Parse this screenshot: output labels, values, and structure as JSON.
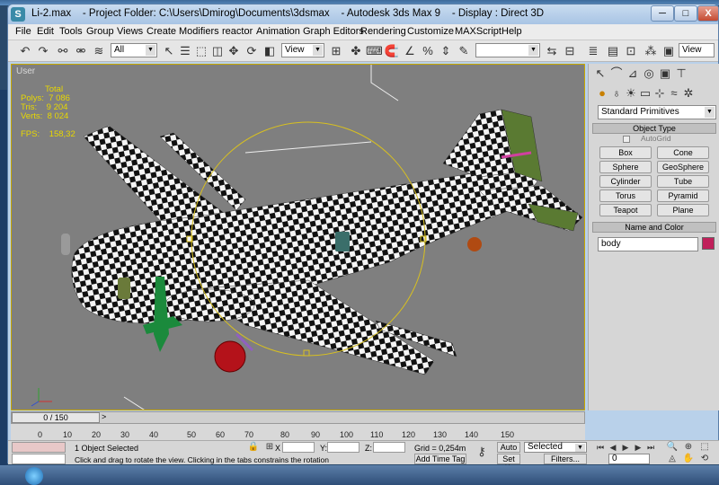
{
  "window": {
    "title": "Li-2.max    - Project Folder: C:\\Users\\Dmirog\\Documents\\3dsmax    - Autodesk 3ds Max 9    - Display : Direct 3D",
    "icon": "3dsmax-app-icon",
    "controls": {
      "minimize": "─",
      "maximize": "□",
      "close": "X"
    }
  },
  "menu": [
    "File",
    "Edit",
    "Tools",
    "Group",
    "Views",
    "Create",
    "Modifiers",
    "reactor",
    "Animation",
    "Graph Editors",
    "Rendering",
    "Customize",
    "MAXScript",
    "Help"
  ],
  "toolbar": {
    "selection_filter": "All",
    "ref_coord": "View",
    "named_selection": "",
    "view_combo_right": "View"
  },
  "viewport": {
    "label": "User",
    "stats_header": "Total",
    "polys": "Polys:  7 086",
    "tris": "Tris:    9 204",
    "verts": "Verts:  8 024",
    "fps": "FPS:    158,32",
    "background_color": "#7f7f7f",
    "selection_color": "#c8a800"
  },
  "command_panel": {
    "category": "Standard Primitives",
    "object_type_header": "Object Type",
    "autogrid": "AutoGrid",
    "buttons": [
      "Box",
      "Cone",
      "Sphere",
      "GeoSphere",
      "Cylinder",
      "Tube",
      "Torus",
      "Pyramid",
      "Teapot",
      "Plane"
    ],
    "name_color_header": "Name and Color",
    "object_name": "body",
    "object_color": "#c0205a"
  },
  "time": {
    "slider": "0 / 150",
    "ticks": [
      "0",
      "10",
      "20",
      "30",
      "40",
      "50",
      "60",
      "70",
      "80",
      "90",
      "100",
      "110",
      "120",
      "130",
      "140",
      "150"
    ]
  },
  "status": {
    "selected": "1 Object Selected",
    "prompt": "Click and drag to rotate the view.  Clicking in the tabs constrains the rotation",
    "x_label": "X",
    "y_label": "Y:",
    "z_label": "Z:",
    "grid": "Grid = 0,254m",
    "add_time_tag": "Add Time Tag",
    "auto": "Auto",
    "selected_combo": "Selected",
    "set_key": "Set K.",
    "filters": "Filters...",
    "frame": "0"
  }
}
